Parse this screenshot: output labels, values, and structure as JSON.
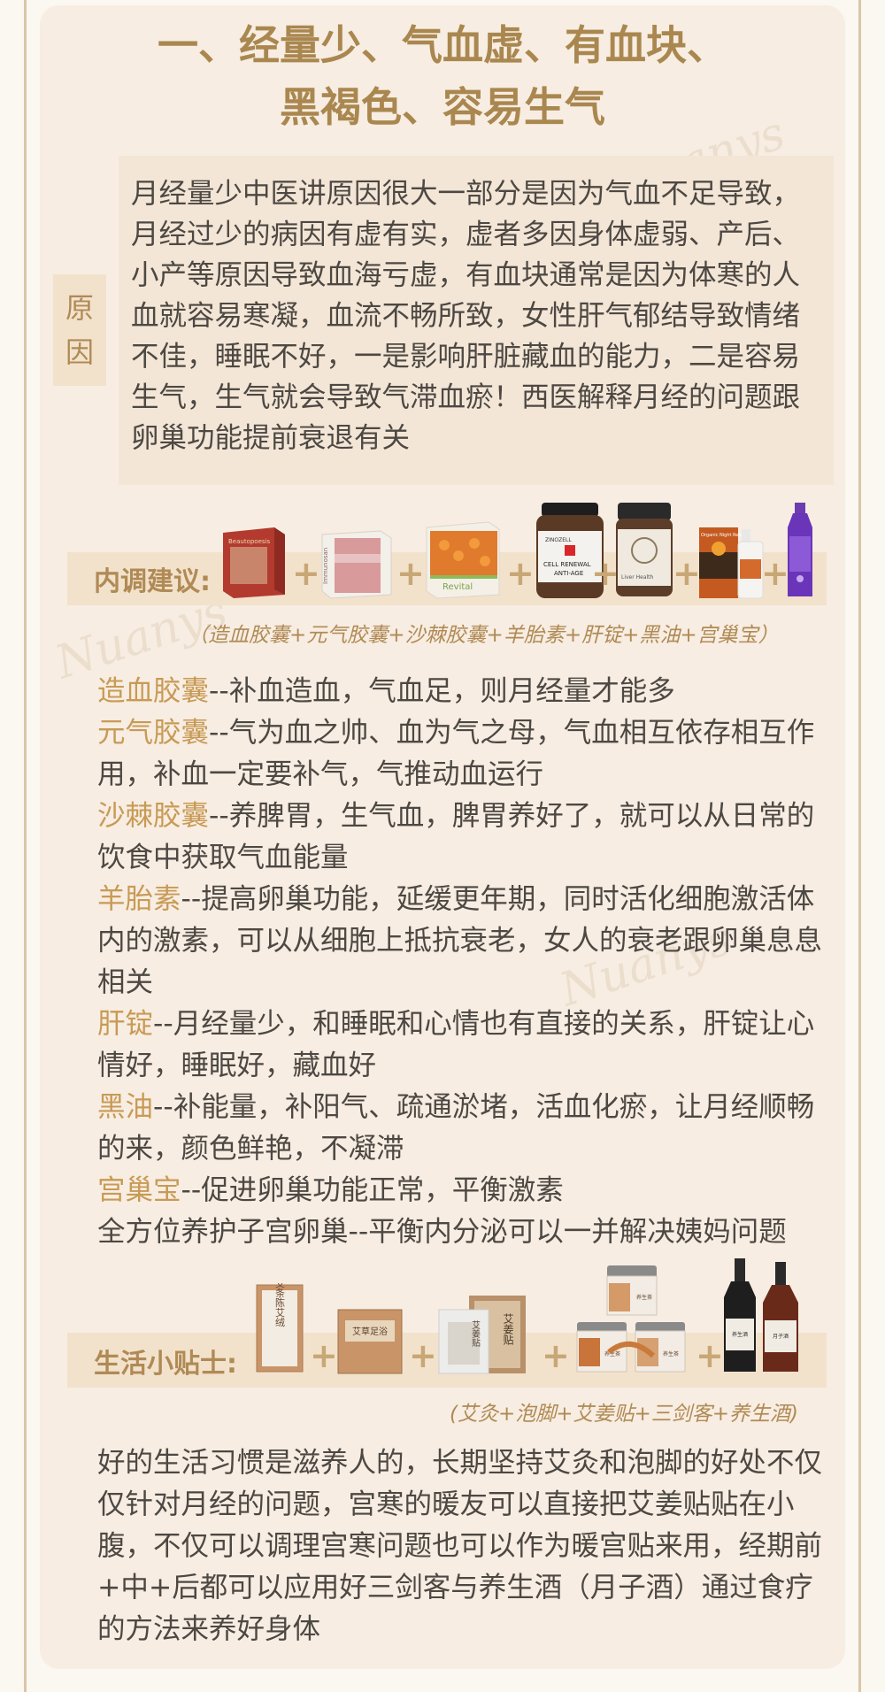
{
  "title": {
    "line1": "一、经量少、气血虚、有血块、",
    "line2": "黑褐色、容易生气"
  },
  "reason": {
    "tag_line1": "原",
    "tag_line2": "因",
    "text": "月经量少中医讲原因很大一部分是因为气血不足导致，月经过少的病因有虚有实，虚者多因身体虚弱、产后、小产等原因导致血海亏虚，有血块通常是因为体寒的人血就容易寒凝，血流不畅所致，女性肝气郁结导致情绪不佳，睡眠不好，一是影响肝脏藏血的能力，二是容易生气，生气就会导致气滞血瘀！西医解释月经的问题跟卵巢功能提前衰退有关"
  },
  "internal": {
    "label": "内调建议:",
    "plus": "+",
    "caption": "（造血胶囊+元气胶囊+沙棘胶囊+羊胎素+肝锭+黑油+宫巢宝）",
    "products": {
      "p1": "Beautopoesis",
      "p2": "Immunosan",
      "p3": "Revital",
      "p4_brand": "ZINOZELL",
      "p4_line1": "CELL RENEWAL",
      "p4_line2": "ANTI-AGE",
      "p5": "Liver Health",
      "p6": "Organic Night Relief"
    },
    "items": [
      {
        "name": "造血胶囊",
        "desc": "--补血造血，气血足，则月经量才能多"
      },
      {
        "name": "元气胶囊",
        "desc": "--气为血之帅、血为气之母，气血相互依存相互作用，补血一定要补气，气推动血运行"
      },
      {
        "name": "沙棘胶囊",
        "desc": "--养脾胃，生气血，脾胃养好了，就可以从日常的饮食中获取气血能量"
      },
      {
        "name": "羊胎素",
        "desc": "--提高卵巢功能，延缓更年期，同时活化细胞激活体内的激素，可以从细胞上抵抗衰老，女人的衰老跟卵巢息息相关"
      },
      {
        "name": "肝锭",
        "desc": "--月经量少，和睡眠和心情也有直接的关系，肝锭让心情好，睡眠好，藏血好"
      },
      {
        "name": "黑油",
        "desc": "--补能量，补阳气、疏通淤堵，活血化瘀，让月经顺畅的来，颜色鲜艳，不凝滞"
      },
      {
        "name": "宫巢宝",
        "desc": "--促进卵巢功能正常，平衡激素"
      }
    ],
    "extra": "全方位养护子宫卵巢--平衡内分泌可以一并解决姨妈问题"
  },
  "life": {
    "label": "生活小贴士:",
    "plus": "+",
    "caption": "(艾灸+泡脚+艾姜贴+三剑客+养生酒)",
    "products": {
      "box1": "艾条陈艾绒",
      "box2": "艾草足浴",
      "box3": "艾姜贴",
      "box3b": "艾姜贴",
      "jar1": "养生茶",
      "jar2": "养生茶",
      "jar3": "养生茶",
      "bottle1": "养生酒",
      "bottle2": "月子酒"
    },
    "text": "好的生活习惯是滋养人的，长期坚持艾灸和泡脚的好处不仅仅针对月经的问题，宫寒的暖友可以直接把艾姜贴贴在小腹，不仅可以调理宫寒问题也可以作为暖宫贴来用，经期前+中+后都可以应用好三剑客与养生酒（月子酒）通过食疗的方法来养好身体"
  },
  "watermark": "Nuanys"
}
